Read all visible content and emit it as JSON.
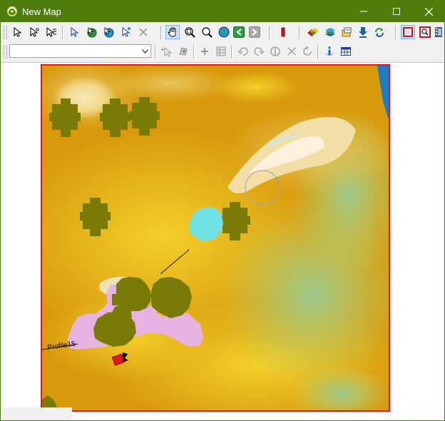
{
  "window": {
    "title": "New Map",
    "minimize_label": "—",
    "maximize_label": "☐",
    "close_label": "✕"
  },
  "toolbar": {
    "layer_select_value": "",
    "row1_icons": [
      "select-arrow-icon",
      "select-edit-icon",
      "select-attribute-icon",
      "select-feature-icon",
      "globe-select-icon",
      "globe-select-2-icon",
      "globe-select-3-icon",
      "pointer-star-icon",
      "delete-x-icon",
      "pan-hand-icon",
      "zoom-area-icon",
      "zoom-icon",
      "globe-icon",
      "back-arrow-icon",
      "forward-arrow-icon",
      "pencil-icon",
      "layers-color-icon",
      "layers-stack-icon",
      "map-layers-icon",
      "download-arrow-icon",
      "refresh-arrows-icon",
      "frame-select-icon",
      "frame-zoom-icon",
      "film-icon"
    ],
    "row2_icons": [
      "add-point-icon",
      "edit-shape-icon",
      "plus-icon",
      "grid-icon",
      "undo-icon",
      "redo-icon",
      "merge-icon",
      "cross-icon",
      "rotate-icon",
      "info-icon",
      "table-icon"
    ]
  },
  "map": {
    "profile_label": "Profile15",
    "colors": {
      "frame_border": "#e8141b",
      "low_terrain": "#d89a0c",
      "mid_terrain": "#f2c60a",
      "high_terrain": "#f7e6b4",
      "green_terrain": "#8fc694",
      "water": "#1f7bc4",
      "olive_area": "#7a7a07",
      "pink_area": "#e7b3e3",
      "cyan_area": "#6fe3e3",
      "flag": "#e8141b"
    }
  }
}
